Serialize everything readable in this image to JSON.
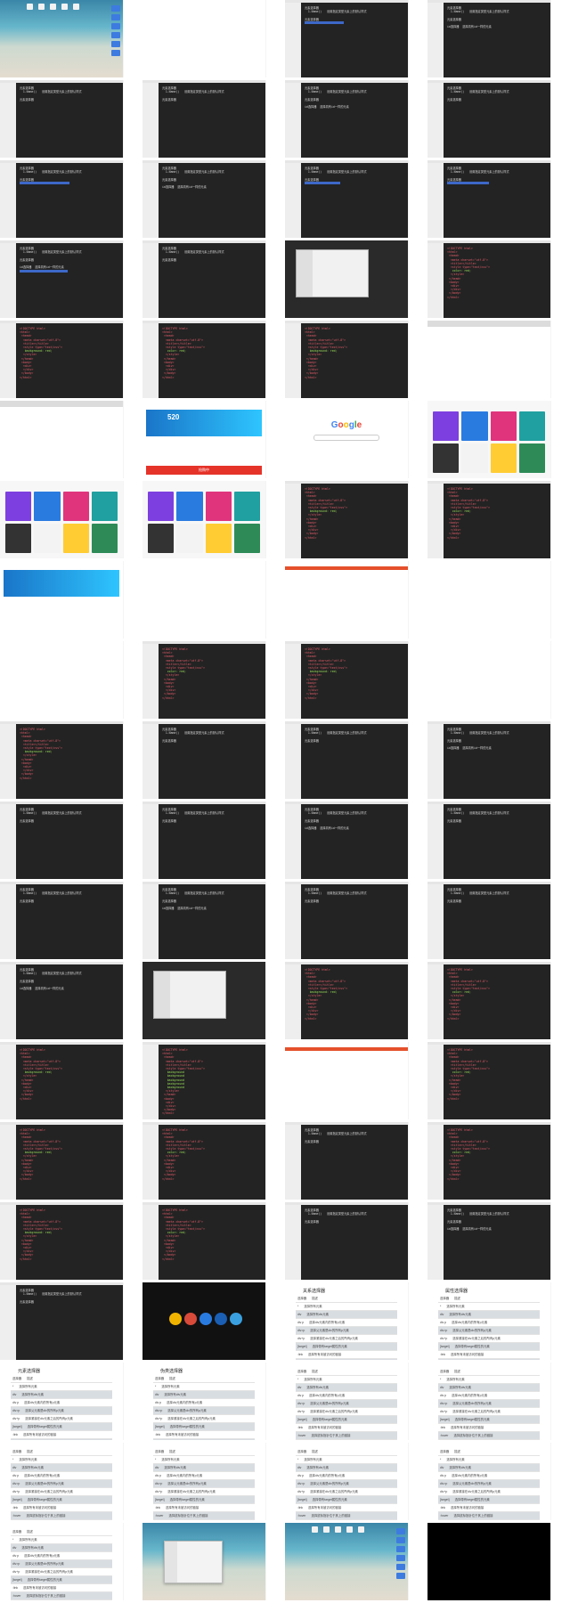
{
  "grid": {
    "columns": 4,
    "rows": 20
  },
  "code": {
    "doctype": "<!DOCTYPE html>",
    "html_open": "<html>",
    "head_open": "<head>",
    "meta": "<meta charset=\"utf-8\">",
    "title_open": "<title></title>",
    "style_open": "<style type=\"text/css\">",
    "style_close": "</style>",
    "head_close": "</head>",
    "body_open": "<body>",
    "div_open": "<div>",
    "div_close": "</div>",
    "p_open": "<p>",
    "p_close": "</p>",
    "span_open": "<span>",
    "body_close": "</body>",
    "html_close": "</html>",
    "color_rule": "color: red;",
    "bg_rule": "background: red;",
    "width_rule": "width: 100px;",
    "height_rule": "height: 100px;",
    "bg_list": [
      "background",
      "background",
      "background",
      "background",
      "background"
    ],
    "div_id": "<div id=\"box\"></div>"
  },
  "notes": {
    "n1": "元素选择器",
    "n2": "1.Name()",
    "n3": "元素选择器",
    "n4": "设置指定类型元素上的默认样式",
    "n5": "id选择器",
    "n6": "选择具有id一样的元素",
    "n7": "属性选择器",
    "n8": "选择器"
  },
  "web": {
    "google_logo": [
      "G",
      "o",
      "o",
      "g",
      "l",
      "e"
    ],
    "shop_number": "520",
    "shop_promo": "抢购中"
  },
  "doc": {
    "title_selector": "元素选择器",
    "title_relation": "关系选择器",
    "title_attr": "属性选择器",
    "title_pseudo": "伪类选择器",
    "col_selector": "选择器",
    "col_desc": "描述",
    "rows": [
      [
        "*",
        "选择所有元素"
      ],
      [
        "div",
        "选择所有div元素"
      ],
      [
        "div p",
        "选择div元素内的所有p元素"
      ],
      [
        "div>p",
        "选择父元素是div的所有p元素"
      ],
      [
        "div+p",
        "选择紧接在div元素之后的所有p元素"
      ],
      [
        "[target]",
        "选择带有target属性的元素"
      ],
      [
        ":link",
        "选择所有未被访问的链接"
      ],
      [
        ":hover",
        "选择鼠标指针位于其上的链接"
      ]
    ]
  },
  "colors": {
    "editor_bg": "#232323",
    "tag": "#e35d6a",
    "attr": "#9be05a",
    "string": "#e6db74",
    "selection": "#3d68c8",
    "google_blue": "#4285f4",
    "promo_red": "#e5332a"
  }
}
